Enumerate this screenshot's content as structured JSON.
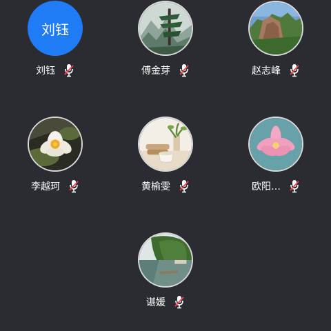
{
  "participants": [
    {
      "name": "刘钰",
      "avatar_text": "刘钰",
      "avatar_type": "text",
      "avatar_color": "#1f7cf4",
      "mic_status": "muted-mic-icon"
    },
    {
      "name": "傅金芽",
      "avatar_type": "image",
      "avatar_image": "mountain-pine-photo",
      "mic_status": "muted-mic-icon"
    },
    {
      "name": "赵志峰",
      "avatar_type": "image",
      "avatar_image": "rock-cliff-landscape-photo",
      "mic_status": "muted-mic-icon"
    },
    {
      "name": "李越珂",
      "avatar_type": "image",
      "avatar_image": "white-lotus-flower-photo",
      "mic_status": "muted-mic-icon"
    },
    {
      "name": "黄榆雯",
      "avatar_type": "image",
      "avatar_image": "teacup-plant-still-life-photo",
      "mic_status": "muted-mic-icon"
    },
    {
      "name": "欧阳…",
      "avatar_type": "image",
      "avatar_image": "pink-lotus-flower-photo",
      "mic_status": "muted-mic-icon"
    },
    {
      "name": "谌媛",
      "avatar_type": "image",
      "avatar_image": "river-forest-landscape-photo",
      "mic_status": "muted-mic-icon"
    }
  ],
  "colors": {
    "background": "#2b2c31",
    "mic_muted_slash": "#e5484d",
    "mic_body": "#ffffff",
    "name_text": "#ffffff"
  }
}
